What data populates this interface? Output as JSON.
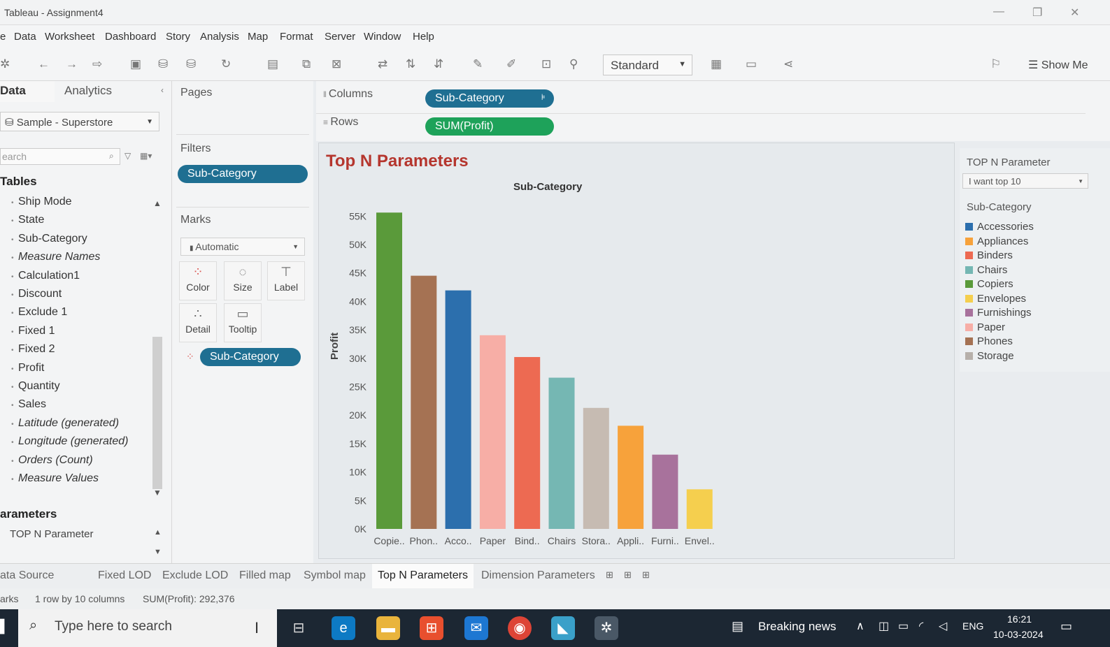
{
  "window": {
    "title": "Tableau - Assignment4"
  },
  "menu": [
    "e",
    "Data",
    "Worksheet",
    "Dashboard",
    "Story",
    "Analysis",
    "Map",
    "Format",
    "Server",
    "Window",
    "Help"
  ],
  "toolbar": {
    "fit_mode": "Standard",
    "show_me": "Show Me"
  },
  "sidebar": {
    "tab_data": "Data",
    "tab_analytics": "Analytics",
    "datasource": "Sample - Superstore",
    "search_placeholder": "earch",
    "tables_heading": "Tables",
    "fields": [
      {
        "label": "Ship Mode",
        "italic": false
      },
      {
        "label": "State",
        "italic": false
      },
      {
        "label": "Sub-Category",
        "italic": false
      },
      {
        "label": "Measure Names",
        "italic": true
      },
      {
        "label": "Calculation1",
        "italic": false
      },
      {
        "label": "Discount",
        "italic": false
      },
      {
        "label": "Exclude 1",
        "italic": false
      },
      {
        "label": "Fixed 1",
        "italic": false
      },
      {
        "label": "Fixed 2",
        "italic": false
      },
      {
        "label": "Profit",
        "italic": false
      },
      {
        "label": "Quantity",
        "italic": false
      },
      {
        "label": "Sales",
        "italic": false
      },
      {
        "label": "Latitude (generated)",
        "italic": true
      },
      {
        "label": "Longitude (generated)",
        "italic": true
      },
      {
        "label": "Orders (Count)",
        "italic": true
      },
      {
        "label": "Measure Values",
        "italic": true
      }
    ],
    "parameters_heading": "arameters",
    "parameter_item": "TOP N Parameter"
  },
  "cards": {
    "pages": "Pages",
    "filters": "Filters",
    "filter_pill": "Sub-Category",
    "marks": "Marks",
    "mark_type": "Automatic",
    "mark_buttons": [
      "Color",
      "Size",
      "Label",
      "Detail",
      "Tooltip"
    ],
    "color_pill": "Sub-Category"
  },
  "shelves": {
    "columns_label": "Columns",
    "columns_pill": "Sub-Category",
    "rows_label": "Rows",
    "rows_pill": "SUM(Profit)"
  },
  "viz": {
    "title": "Top N Parameters",
    "header": "Sub-Category",
    "y_axis_label": "Profit"
  },
  "chart_data": {
    "type": "bar",
    "categories": [
      "Copie..",
      "Phon..",
      "Acco..",
      "Paper",
      "Bind..",
      "Chairs",
      "Stora..",
      "Appli..",
      "Furni..",
      "Envel.."
    ],
    "values": [
      55618,
      44516,
      41937,
      34054,
      30222,
      26590,
      21279,
      18138,
      13059,
      6964
    ],
    "colors": [
      "#5a9a3a",
      "#a57253",
      "#2c6fad",
      "#f7aea6",
      "#ed6a52",
      "#75b7b3",
      "#c6bbb2",
      "#f7a23b",
      "#a8729c",
      "#f5cf4e"
    ],
    "ylabel": "Profit",
    "xlabel": "",
    "ylim": [
      0,
      57000
    ],
    "y_ticks": [
      0,
      5000,
      10000,
      15000,
      20000,
      25000,
      30000,
      35000,
      40000,
      45000,
      50000,
      55000
    ],
    "y_tick_labels": [
      "0K",
      "5K",
      "10K",
      "15K",
      "20K",
      "25K",
      "30K",
      "35K",
      "40K",
      "45K",
      "50K",
      "55K"
    ],
    "grid": false,
    "legend": "right"
  },
  "legend_panel": {
    "param_title": "TOP N Parameter",
    "param_value": "I want top 10",
    "color_title": "Sub-Category",
    "items": [
      {
        "label": "Accessories",
        "color": "#2c6fad"
      },
      {
        "label": "Appliances",
        "color": "#f7a23b"
      },
      {
        "label": "Binders",
        "color": "#ed6a52"
      },
      {
        "label": "Chairs",
        "color": "#75b7b3"
      },
      {
        "label": "Copiers",
        "color": "#5a9a3a"
      },
      {
        "label": "Envelopes",
        "color": "#f5cf4e"
      },
      {
        "label": "Furnishings",
        "color": "#a8729c"
      },
      {
        "label": "Paper",
        "color": "#f7aea6"
      },
      {
        "label": "Phones",
        "color": "#a57253"
      },
      {
        "label": "Storage",
        "color": "#b7b0aa"
      }
    ]
  },
  "sheet_tabs": [
    "ata Source",
    "Fixed LOD",
    "Exclude LOD",
    "Filled map",
    "Symbol map",
    "Top N Parameters",
    "Dimension Parameters"
  ],
  "status": {
    "marks": "arks",
    "dims": "1 row by 10 columns",
    "sum": "SUM(Profit): 292,376"
  },
  "taskbar": {
    "search_placeholder": "Type here to search",
    "news": "Breaking news",
    "lang": "ENG",
    "time": "16:21",
    "date": "10-03-2024"
  }
}
